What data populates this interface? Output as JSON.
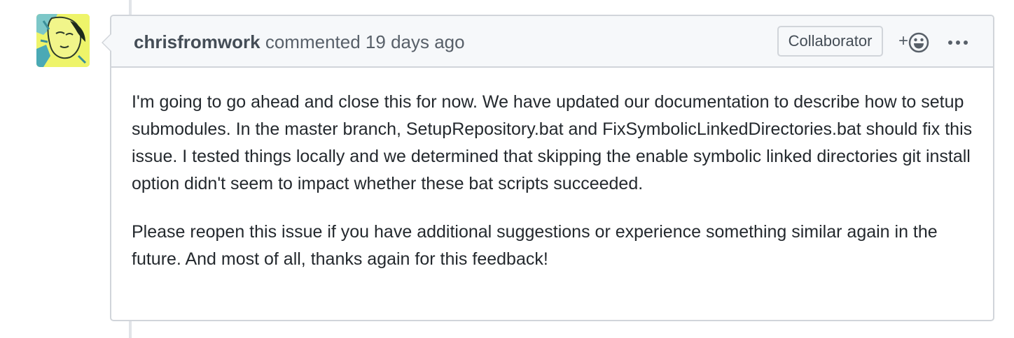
{
  "comment": {
    "author": "chrisfromwork",
    "action": "commented",
    "timestamp": "19 days ago",
    "role_badge": "Collaborator",
    "reaction_plus": "+",
    "body": [
      "I'm going to go ahead and close this for now. We have updated our documentation to describe how to setup submodules. In the master branch, SetupRepository.bat and FixSymbolicLinkedDirectories.bat should fix this issue. I tested things locally and we determined that skipping the enable symbolic linked directories git install option didn't seem to impact whether these bat scripts succeeded.",
      "Please reopen this issue if you have additional suggestions or experience something similar again in the future. And most of all, thanks again for this feedback!"
    ]
  },
  "icons": {
    "reaction": "smiley-icon",
    "more": "kebab-horizontal-icon"
  },
  "colors": {
    "header_bg": "#f6f8fa",
    "border": "#d1d5da",
    "text": "#24292e",
    "muted": "#586069",
    "avatar_bg": "#e9f26a"
  }
}
